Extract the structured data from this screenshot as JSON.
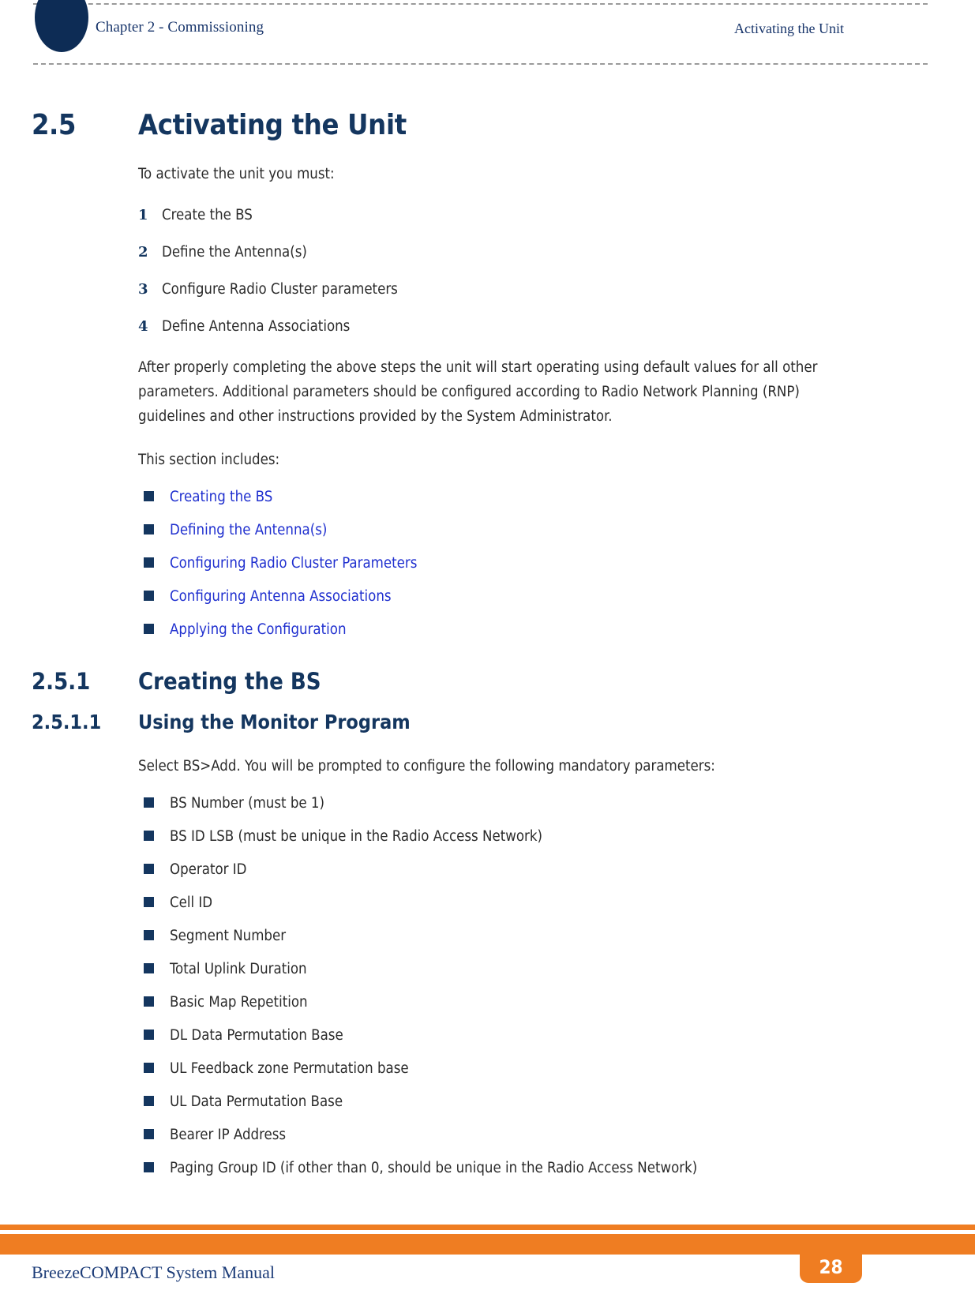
{
  "header": {
    "chapter": "Chapter 2 - Commissioning",
    "section": "Activating the Unit"
  },
  "colors": {
    "navy": "#14365f",
    "header_navy": "#18356b",
    "link_blue": "#2030cf",
    "orange": "#ef7d22",
    "body_text": "#2b2b2b",
    "dash_gray": "#9a9a9a"
  },
  "sections": {
    "main": {
      "number": "2.5",
      "title": "Activating the Unit",
      "intro": "To activate the unit you must:",
      "steps": [
        {
          "n": "1",
          "text": "Create the BS"
        },
        {
          "n": "2",
          "text": "Define the Antenna(s)"
        },
        {
          "n": "3",
          "text": "Configure Radio Cluster parameters"
        },
        {
          "n": "4",
          "text": "Define Antenna Associations"
        }
      ],
      "paragraph": "After properly completing the above steps the unit will start operating using default values for all other parameters. Additional parameters should be configured according to Radio Network Planning (RNP) guidelines and other instructions provided by the System Administrator.",
      "includes_label": "This section includes:",
      "toc_links": [
        "Creating the BS",
        "Defining the Antenna(s)",
        "Configuring Radio Cluster Parameters",
        "Configuring Antenna Associations",
        "Applying the Configuration"
      ]
    },
    "sub": {
      "number": "2.5.1",
      "title": "Creating the BS"
    },
    "subsub": {
      "number": "2.5.1.1",
      "title": "Using the Monitor Program",
      "intro": "Select BS>Add. You will be prompted to configure the following mandatory parameters:",
      "parameters": [
        "BS Number (must be 1)",
        "BS ID LSB (must be unique in the Radio Access Network)",
        "Operator ID",
        "Cell ID",
        "Segment Number",
        "Total Uplink Duration",
        "Basic Map Repetition",
        "DL Data Permutation Base",
        "UL Feedback zone Permutation base",
        "UL Data Permutation Base",
        "Bearer IP Address",
        "Paging Group ID (if other than 0, should be unique in the Radio Access Network)"
      ]
    }
  },
  "footer": {
    "manual_title": "BreezeCOMPACT System Manual",
    "page_number": "28"
  }
}
